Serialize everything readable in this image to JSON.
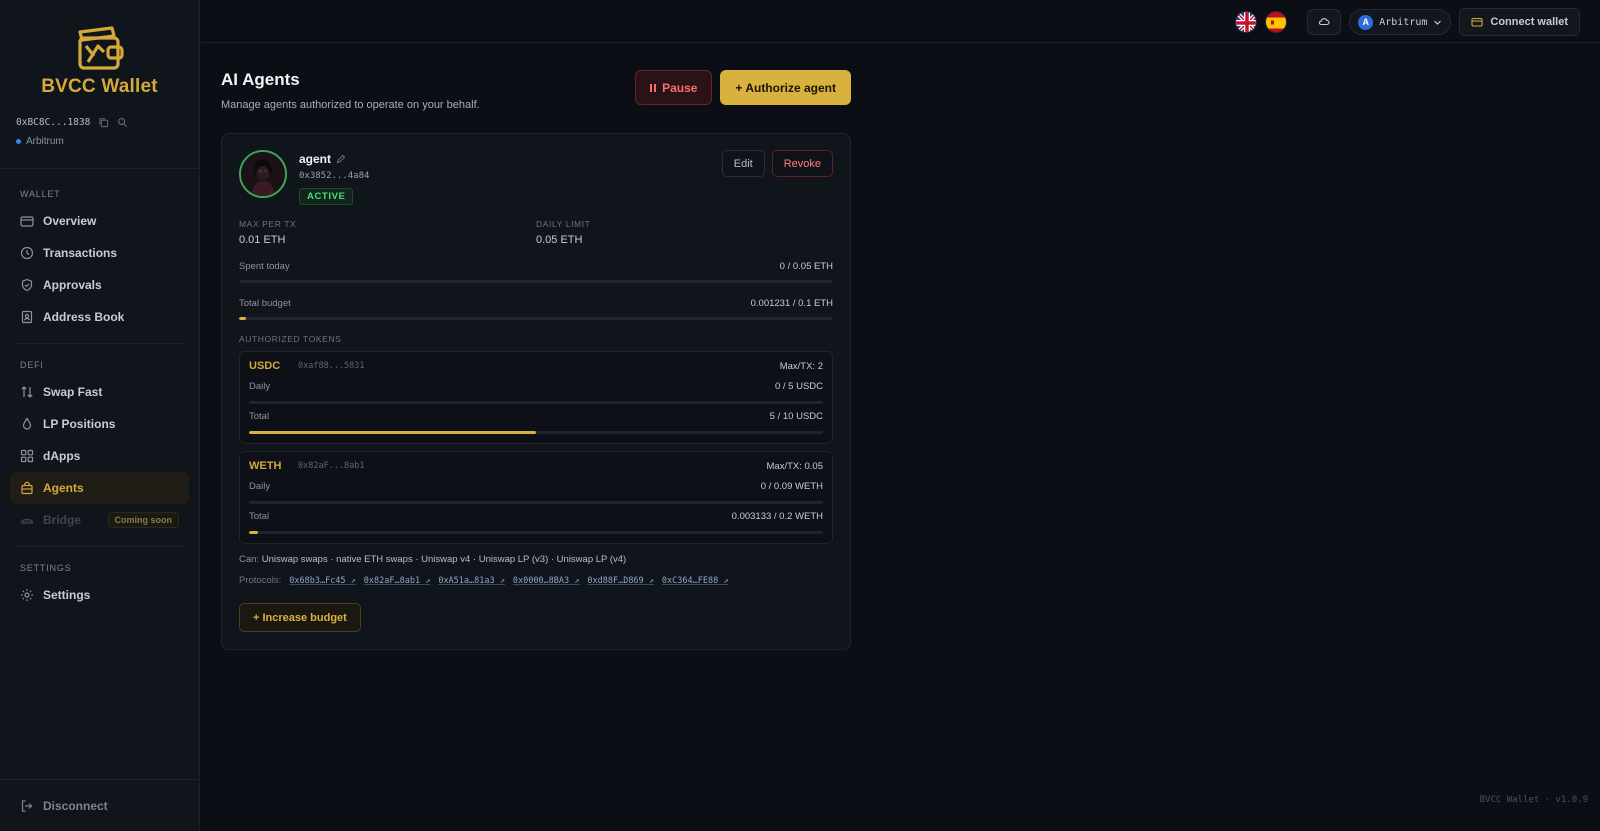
{
  "app": {
    "name": "BVCC Wallet",
    "version": "BVCC Wallet · v1.0.9"
  },
  "account": {
    "address": "0xBC8C...1838",
    "network": "Arbitrum"
  },
  "sidebar": {
    "sections": [
      {
        "title": "WALLET"
      },
      {
        "title": "DEFI"
      },
      {
        "title": "SETTINGS"
      }
    ],
    "wallet_items": [
      {
        "label": "Overview",
        "icon": "card-icon"
      },
      {
        "label": "Transactions",
        "icon": "clock-icon"
      },
      {
        "label": "Approvals",
        "icon": "shield-icon"
      },
      {
        "label": "Address Book",
        "icon": "contact-book-icon"
      }
    ],
    "defi_items": [
      {
        "label": "Swap Fast",
        "icon": "swap-arrows-icon"
      },
      {
        "label": "LP Positions",
        "icon": "droplet-icon"
      },
      {
        "label": "dApps",
        "icon": "grid-icon"
      },
      {
        "label": "Agents",
        "icon": "bag-icon",
        "active": true
      },
      {
        "label": "Bridge",
        "icon": "bridge-icon",
        "disabled": true,
        "badge": "Coming soon"
      }
    ],
    "settings_items": [
      {
        "label": "Settings",
        "icon": "gear-icon"
      }
    ],
    "disconnect": "Disconnect"
  },
  "topbar": {
    "network": "Arbitrum",
    "network_badge": "A",
    "connect_label": "Connect wallet"
  },
  "page": {
    "title": "AI Agents",
    "subtitle": "Manage agents authorized to operate on your behalf.",
    "pause_label": "Pause",
    "authorize_label": "+ Authorize agent"
  },
  "agent": {
    "name": "agent",
    "address": "0x3852...4a84",
    "status": "ACTIVE",
    "edit_label": "Edit",
    "revoke_label": "Revoke",
    "max_per_tx_label": "MAX PER TX",
    "max_per_tx": "0.01 ETH",
    "daily_limit_label": "DAILY LIMIT",
    "daily_limit": "0.05 ETH",
    "spent_today_label": "Spent today",
    "spent_today": "0 / 0.05 ETH",
    "spent_today_fraction": 0,
    "total_budget_label": "Total budget",
    "total_budget": "0.001231 / 0.1 ETH",
    "total_budget_fraction": 0.012,
    "authorized_tokens_label": "AUTHORIZED TOKENS",
    "tokens": [
      {
        "symbol": "USDC",
        "address": "0xaf88...5831",
        "max_tx": "Max/TX: 2",
        "daily_label": "Daily",
        "daily": "0 / 5 USDC",
        "daily_fraction": 0,
        "total_label": "Total",
        "total": "5 / 10 USDC",
        "total_fraction": 0.5
      },
      {
        "symbol": "WETH",
        "address": "0x82aF...8ab1",
        "max_tx": "Max/TX: 0.05",
        "daily_label": "Daily",
        "daily": "0 / 0.09 WETH",
        "daily_fraction": 0,
        "total_label": "Total",
        "total": "0.003133 / 0.2 WETH",
        "total_fraction": 0.016
      }
    ],
    "can_label": "Can:",
    "can_items": "Uniswap swaps · native ETH swaps · Uniswap v4 · Uniswap LP (v3) · Uniswap LP (v4)",
    "protocols_label": "Protocols:",
    "protocols": [
      "0x68b3…Fc45 ↗",
      "0x82aF…8ab1 ↗",
      "0xA51a…81a3 ↗",
      "0x0000…8BA3 ↗",
      "0xd88F…D869 ↗",
      "0xC364…FE88 ↗"
    ],
    "increase_label": "+ Increase budget"
  },
  "colors": {
    "accent": "#d9b13f",
    "danger": "#ff6b6b",
    "success": "#4ade80",
    "background": "#0b0e14"
  }
}
